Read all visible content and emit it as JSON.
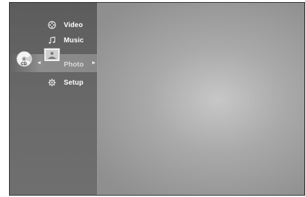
{
  "menu": {
    "items": [
      {
        "label": "Video",
        "icon": "film-reel-icon"
      },
      {
        "label": "Music",
        "icon": "music-note-icon"
      },
      {
        "label": "Photo",
        "icon": "photo-icon",
        "selected": true
      },
      {
        "label": "Setup",
        "icon": "gear-icon"
      }
    ]
  },
  "disc": {
    "label": "CD",
    "icon": "cd-disc-icon"
  },
  "colors": {
    "panel": "#5c5c5c",
    "background": "#a9a9a9",
    "text": "#ffffff",
    "selected_text": "#d9d9d9"
  }
}
